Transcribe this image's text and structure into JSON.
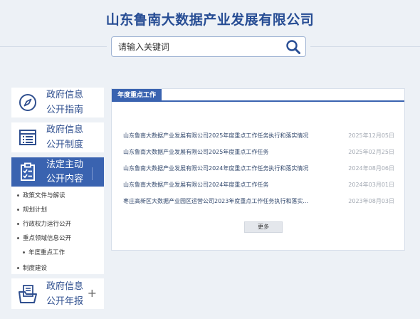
{
  "site": {
    "title": "山东鲁南大数据产业发展有限公司"
  },
  "search": {
    "placeholder": "请输入关键词"
  },
  "sidebar": {
    "items": [
      {
        "line1": "政府信息",
        "line2": "公开指南"
      },
      {
        "line1": "政府信息",
        "line2": "公开制度"
      },
      {
        "line1": "法定主动",
        "line2": "公开内容"
      },
      {
        "line1": "政府信息",
        "line2": "公开年报"
      }
    ],
    "submenu": [
      "政策文件与解读",
      "规划计划",
      "行政权力运行公开",
      "重点领域信息公开",
      "年度重点工作",
      "制度建设"
    ]
  },
  "panel": {
    "tab_label": "年度重点工作",
    "more_label": "更多",
    "news": [
      {
        "title": "山东鲁南大数据产业发展有限公司2025年度重点工作任务执行和落实情况",
        "date": "2025年12月05日"
      },
      {
        "title": "山东鲁南大数据产业发展有限公司2025年度重点工作任务",
        "date": "2025年02月25日"
      },
      {
        "title": "山东鲁南大数据产业发展有限公司2024年度重点工作任务执行和落实情况",
        "date": "2024年08月06日"
      },
      {
        "title": "山东鲁南大数据产业发展有限公司2024年度重点工作任务",
        "date": "2024年03月01日"
      },
      {
        "title": "枣庄高新区大数据产业园区运营公司2023年度重点工作任务执行和落实...",
        "date": "2023年08月03日"
      }
    ]
  },
  "colors": {
    "brand": "#274d94",
    "accent": "#3a63b0",
    "background": "#edf1f6"
  },
  "icons": [
    "search-icon",
    "compass-icon",
    "list-icon",
    "checklist-icon",
    "document-folder-icon",
    "plus-icon"
  ]
}
